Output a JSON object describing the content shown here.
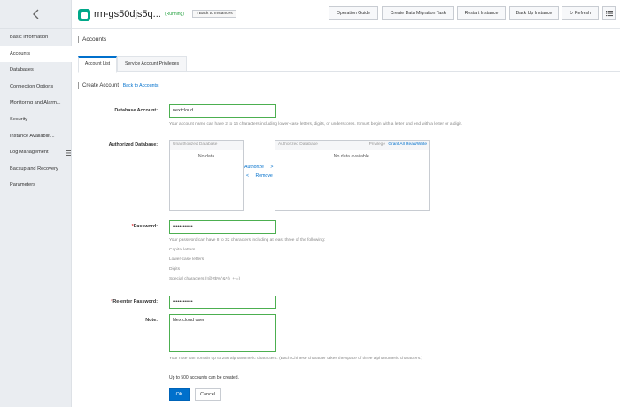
{
  "sidebar": {
    "items": [
      {
        "label": "Basic Information"
      },
      {
        "label": "Accounts"
      },
      {
        "label": "Databases"
      },
      {
        "label": "Connection Options"
      },
      {
        "label": "Monitoring and Alarm..."
      },
      {
        "label": "Security"
      },
      {
        "label": "Instance Availabilit..."
      },
      {
        "label": "Log Management"
      },
      {
        "label": "Backup and Recovery"
      },
      {
        "label": "Parameters"
      }
    ],
    "active_index": 1
  },
  "header": {
    "instance_title": "rm-gs50djs5q...",
    "status": "(Running)",
    "back_link": "Back to Instances",
    "buttons": {
      "operation_guide": "Operation Guide",
      "create_migration": "Create Data Migration Task",
      "restart": "Restart Instance",
      "backup": "Back Up Instance",
      "refresh": "Refresh"
    }
  },
  "page": {
    "title": "Accounts",
    "tabs": [
      "Account List",
      "Service Account Privileges"
    ],
    "active_tab": 0,
    "section_title": "Create Account",
    "back_to_accounts": "Back to Accounts"
  },
  "form": {
    "db_account": {
      "label": "Database Account:",
      "value": "nextcloud",
      "help": "Your account name can have 2 to 16 characters including lower-case letters, digits, or underscores. It must begin with a letter and end with a letter or a digit."
    },
    "authorized_db": {
      "label": "Authorized Database:",
      "unauth_header": "Unauthorized Database",
      "unauth_empty": "No data",
      "auth_header": "Authorized Database",
      "privilege_label": "Privilege",
      "grant_all": "Grant All Read/Write",
      "auth_empty": "No data available.",
      "authorize_label": "Authorize",
      "authorize_arrow": ">",
      "remove_label": "Remove",
      "remove_arrow": "<"
    },
    "password": {
      "required": "*",
      "label": "Password:",
      "value": "••••••••••••",
      "help_lines": [
        "Your password can have 8 to 32 characters including at least three of the following:",
        "Capital letters",
        "Lower-case letters",
        "Digits",
        "Special characters (!@#$%^&*()_+-=)"
      ]
    },
    "reenter_password": {
      "required": "*",
      "label": "Re-enter Password:",
      "value": "••••••••••••"
    },
    "note": {
      "label": "Note:",
      "value": "Nextcloud user",
      "help": "Your note can contain up to 256 alphanumeric characters. (Each Chinese character takes the space of three alphanumeric characters.)"
    },
    "limit_text": "Up to 500 accounts can be created.",
    "ok_label": "OK",
    "cancel_label": "Cancel"
  },
  "colors": {
    "accent": "#0070cc",
    "input_border": "#4caf50",
    "status": "#1e9e3a",
    "brand_icon": "#00a889"
  }
}
